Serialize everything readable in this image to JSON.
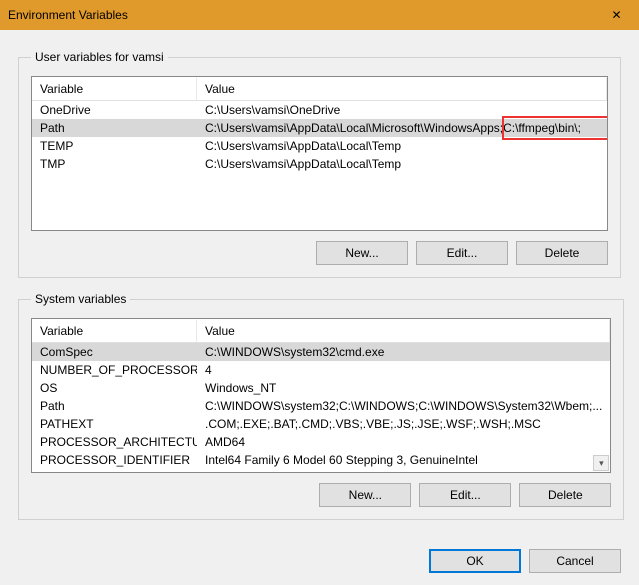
{
  "window": {
    "title": "Environment Variables"
  },
  "user_group": {
    "legend": "User variables for vamsi",
    "header": {
      "variable": "Variable",
      "value": "Value"
    },
    "rows": [
      {
        "name": "OneDrive",
        "value": "C:\\Users\\vamsi\\OneDrive"
      },
      {
        "name": "Path",
        "value": "C:\\Users\\vamsi\\AppData\\Local\\Microsoft\\WindowsApps;C:\\ffmpeg\\bin\\;"
      },
      {
        "name": "TEMP",
        "value": "C:\\Users\\vamsi\\AppData\\Local\\Temp"
      },
      {
        "name": "TMP",
        "value": "C:\\Users\\vamsi\\AppData\\Local\\Temp"
      }
    ],
    "buttons": {
      "new": "New...",
      "edit": "Edit...",
      "delete": "Delete"
    }
  },
  "system_group": {
    "legend": "System variables",
    "header": {
      "variable": "Variable",
      "value": "Value"
    },
    "rows": [
      {
        "name": "ComSpec",
        "value": "C:\\WINDOWS\\system32\\cmd.exe"
      },
      {
        "name": "NUMBER_OF_PROCESSORS",
        "value": "4"
      },
      {
        "name": "OS",
        "value": "Windows_NT"
      },
      {
        "name": "Path",
        "value": "C:\\WINDOWS\\system32;C:\\WINDOWS;C:\\WINDOWS\\System32\\Wbem;..."
      },
      {
        "name": "PATHEXT",
        "value": ".COM;.EXE;.BAT;.CMD;.VBS;.VBE;.JS;.JSE;.WSF;.WSH;.MSC"
      },
      {
        "name": "PROCESSOR_ARCHITECTURE",
        "value": "AMD64"
      },
      {
        "name": "PROCESSOR_IDENTIFIER",
        "value": "Intel64 Family 6 Model 60 Stepping 3, GenuineIntel"
      }
    ],
    "buttons": {
      "new": "New...",
      "edit": "Edit...",
      "delete": "Delete"
    }
  },
  "footer": {
    "ok": "OK",
    "cancel": "Cancel"
  }
}
